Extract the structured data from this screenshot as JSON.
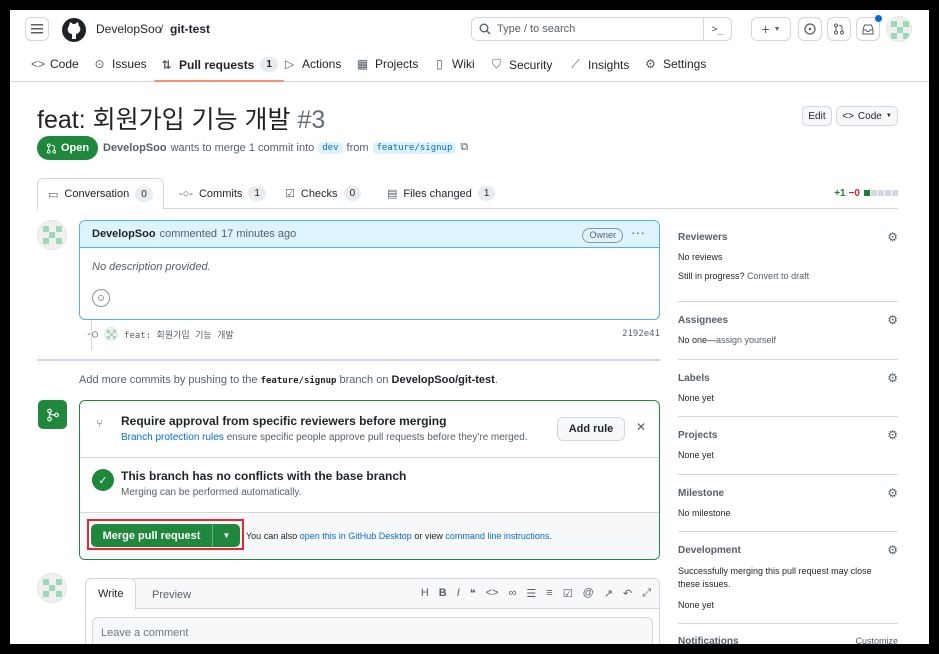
{
  "header": {
    "owner": "DevelopSoo",
    "sep": "/",
    "repo": "git-test",
    "search_placeholder": "Type / to search",
    "new_label": "+",
    "terminal_glyph": ">_"
  },
  "repo_tabs": [
    {
      "label": "Code",
      "icon": "code-icon"
    },
    {
      "label": "Issues",
      "icon": "issue-icon"
    },
    {
      "label": "Pull requests",
      "icon": "pull-request-icon",
      "count": "1",
      "selected": true
    },
    {
      "label": "Actions",
      "icon": "play-icon"
    },
    {
      "label": "Projects",
      "icon": "table-icon"
    },
    {
      "label": "Wiki",
      "icon": "book-icon"
    },
    {
      "label": "Security",
      "icon": "shield-icon"
    },
    {
      "label": "Insights",
      "icon": "graph-icon"
    },
    {
      "label": "Settings",
      "icon": "gear-icon"
    }
  ],
  "pr": {
    "title": "feat: 회원가입 기능 개발",
    "number": "#3",
    "state": "Open",
    "author": "DevelopSoo",
    "wants_text": "wants to merge 1 commit into",
    "base": "dev",
    "from_text": "from",
    "head": "feature/signup",
    "edit_label": "Edit",
    "code_label": "Code"
  },
  "pr_tabs": [
    {
      "label": "Conversation",
      "count": "0",
      "icon": "comment-icon",
      "selected": true
    },
    {
      "label": "Commits",
      "count": "1",
      "icon": "commit-icon"
    },
    {
      "label": "Checks",
      "count": "0",
      "icon": "checks-icon"
    },
    {
      "label": "Files changed",
      "count": "1",
      "icon": "file-diff-icon"
    }
  ],
  "diffstat": {
    "additions": "+1",
    "deletions": "−0"
  },
  "comment": {
    "author": "DevelopSoo",
    "action": "commented",
    "time": "17 minutes ago",
    "role": "Owner",
    "body": "No description provided."
  },
  "commit": {
    "message": "feat: 회원가입 기능 개발",
    "sha": "2192e41"
  },
  "hint": {
    "pre": "Add more commits by pushing to the",
    "branch": "feature/signup",
    "mid": "branch on",
    "repo": "DevelopSoo/git-test",
    "end": "."
  },
  "merge_box": {
    "rule_title": "Require approval from specific reviewers before merging",
    "rule_link": "Branch protection rules",
    "rule_desc": "ensure specific people approve pull requests before they're merged.",
    "add_rule": "Add rule",
    "close": "✕",
    "conflict_title": "This branch has no conflicts with the base branch",
    "conflict_desc": "Merging can be performed automatically.",
    "merge_label": "Merge pull request",
    "alt_pre": "You can also",
    "alt_link1": "open this in GitHub Desktop",
    "alt_mid": "or view",
    "alt_link2": "command line instructions",
    "alt_end": "."
  },
  "editor": {
    "write": "Write",
    "preview": "Preview",
    "placeholder": "Leave a comment"
  },
  "sidebar": {
    "reviewers": {
      "title": "Reviewers",
      "value": "No reviews",
      "draft_pre": "Still in progress?",
      "draft_link": "Convert to draft"
    },
    "assignees": {
      "title": "Assignees",
      "value_pre": "No one—",
      "value_link": "assign yourself"
    },
    "labels": {
      "title": "Labels",
      "value": "None yet"
    },
    "projects": {
      "title": "Projects",
      "value": "None yet"
    },
    "milestone": {
      "title": "Milestone",
      "value": "No milestone"
    },
    "development": {
      "title": "Development",
      "desc": "Successfully merging this pull request may close these issues.",
      "value": "None yet"
    },
    "notifications": {
      "title": "Notifications",
      "customize": "Customize"
    }
  }
}
